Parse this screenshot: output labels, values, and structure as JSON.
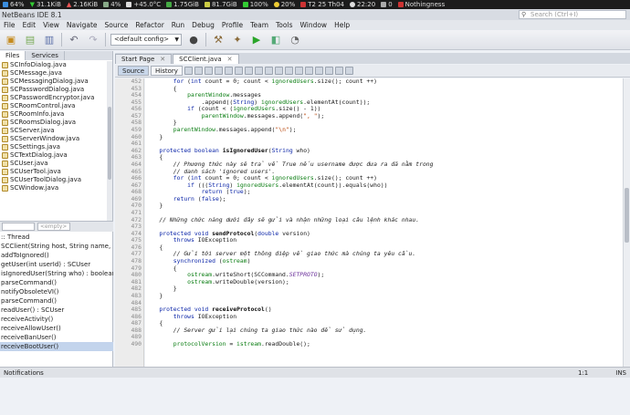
{
  "system_bar": {
    "items": [
      "64%",
      "31.1KiB",
      "2.16KiB",
      "4%",
      "+45.0°C",
      "1.75GiB",
      "81.7GiB",
      "100%",
      "20%",
      "T2 25 Th04",
      "22:20",
      "0",
      "Nothingness"
    ]
  },
  "window": {
    "title": "NetBeans IDE 8.1",
    "search_placeholder": "Search (Ctrl+I)"
  },
  "menu": [
    "File",
    "Edit",
    "View",
    "Navigate",
    "Source",
    "Refactor",
    "Run",
    "Debug",
    "Profile",
    "Team",
    "Tools",
    "Window",
    "Help"
  ],
  "toolbar": {
    "config_value": "<default config>"
  },
  "left_panel": {
    "tabs": [
      "Files",
      "Services"
    ],
    "files": [
      "SCInfoDialog.java",
      "SCMessage.java",
      "SCMessagingDialog.java",
      "SCPasswordDialog.java",
      "SCPasswordEncryptor.java",
      "SCRoomControl.java",
      "SCRoomInfo.java",
      "SCRoomsDialog.java",
      "SCServer.java",
      "SCServerWindow.java",
      "SCSettings.java",
      "SCTextDialog.java",
      "SCUser.java",
      "SCUserTool.java",
      "SCUserToolDialog.java",
      "SCWindow.java"
    ],
    "navigator_filter": "<empty>",
    "members": [
      ":: Thread",
      "SCClient(String host, String name, int p",
      "addToIgnored()",
      "getUser(int userId) : SCUser",
      "isIgnoredUser(String who) : boolean",
      "parseCommand()",
      "notifyObsoleteVI()",
      "parseCommand()",
      "readUser() : SCUser",
      "receiveActivity()",
      "receiveAllowUser()",
      "receiveBanUser()",
      "receiveBootUser()"
    ]
  },
  "editor": {
    "tabs": [
      "Start Page",
      "SCClient.java"
    ],
    "view_buttons": [
      "Source",
      "History"
    ],
    "line_numbers": [
      "452",
      "453",
      "454",
      "455",
      "456",
      "457",
      "458",
      "459",
      "460",
      "461",
      "462",
      "463",
      "464",
      "465",
      "466",
      "467",
      "468",
      "469",
      "470",
      "471",
      "472",
      "473",
      "474",
      "475",
      "476",
      "477",
      "478",
      "479",
      "480",
      "481",
      "482",
      "483",
      "484",
      "485",
      "486",
      "487",
      "488",
      "489",
      "490"
    ],
    "lines": [
      "        for (int count = 0; count < ignoredUsers.size(); count ++)",
      "        {",
      "            parentWindow.messages",
      "                .append((String) ignoredUsers.elementAt(count));",
      "            if (count < (ignoredUsers.size() - 1))",
      "                parentWindow.messages.append(\", \");",
      "        }",
      "        parentWindow.messages.append(\"\\n\");",
      "    }",
      "",
      "    protected boolean isIgnoredUser(String who)",
      "    {",
      "        // Phương thức này sẽ trả về True nếu username được đưa ra đã nằm trong",
      "        // danh sách 'ignored users'.",
      "        for (int count = 0; count < ignoredUsers.size(); count ++)",
      "            if (((String) ignoredUsers.elementAt(count)).equals(who))",
      "                return (true);",
      "        return (false);",
      "    }",
      "",
      "    // Những chức năng dưới đây sẽ gửi và nhận những loại câu lệnh khác nhau.",
      "",
      "    protected void sendProtocol(double version)",
      "        throws IOException",
      "    {",
      "        // Gửi tới server một thông điệp về giao thức mà chúng ta yêu cầu.",
      "        synchronized (ostream)",
      "        {",
      "            ostream.writeShort(SCCommand.SETPROTO);",
      "            ostream.writeDouble(version);",
      "        }",
      "    }",
      "",
      "    protected void receiveProtocol()",
      "        throws IOException",
      "    {",
      "        // Server gửi lại chúng ta giao thức nào để sử dụng.",
      "",
      "        protocolVersion = istream.readDouble();"
    ]
  },
  "status_bar": {
    "left": "Notifications",
    "position": "1:1",
    "mode": "INS"
  }
}
